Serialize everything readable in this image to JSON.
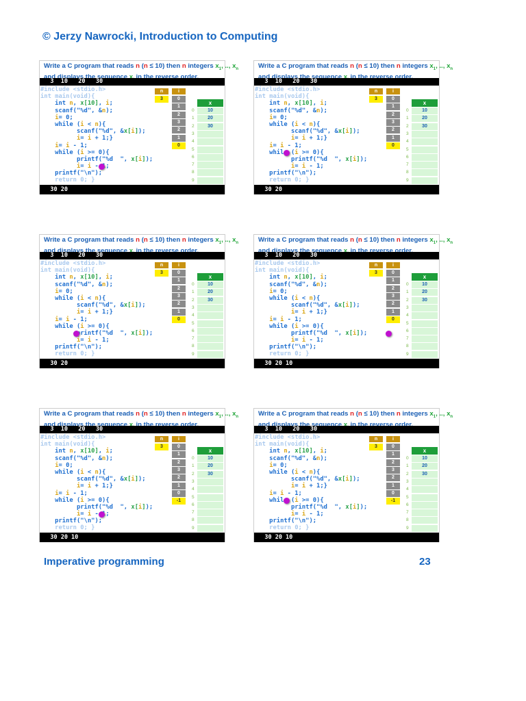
{
  "header": "© Jerzy Nawrocki, Introduction to Computing",
  "footer": {
    "left": "Imperative programming",
    "page": "23"
  },
  "slide_common": {
    "title_line1": [
      "Write a C program that reads ",
      "n",
      " (",
      "n",
      " ≤ 10) then ",
      "n",
      " integers  ",
      "x",
      "1",
      ", .., ",
      "x",
      "n"
    ],
    "title_line2": [
      "and displays the sequence ",
      "x",
      "i",
      " in the reverse order."
    ],
    "input": "   3  10   20   30",
    "n_label": "n",
    "n_value": "3",
    "i_label": "i",
    "x_label": "x",
    "x_indices": [
      "0",
      "1",
      "2",
      "3",
      "4",
      "5",
      "6",
      "7",
      "8",
      "9"
    ],
    "x_values": [
      "10",
      "20",
      "30",
      "",
      "",
      "",
      "",
      "",
      "",
      ""
    ],
    "code": [
      [
        [
          "#include <stdio.h>",
          "lt"
        ]
      ],
      [
        [
          "int main(void){",
          "lt"
        ]
      ],
      [
        [
          "    int ",
          ""
        ],
        [
          "n",
          "v"
        ],
        [
          ", ",
          ""
        ],
        [
          "x[10]",
          "g"
        ],
        [
          ", ",
          ""
        ],
        [
          "i",
          "v"
        ],
        [
          ";",
          ""
        ]
      ],
      [
        [
          "    scanf(\"%d\", &",
          ""
        ],
        [
          "n",
          "v"
        ],
        [
          ");",
          ""
        ]
      ],
      [
        [
          "    ",
          ""
        ],
        [
          "i",
          "v"
        ],
        [
          "= 0;",
          ""
        ]
      ],
      [
        [
          "    while (",
          ""
        ],
        [
          "i",
          "v"
        ],
        [
          " < ",
          ""
        ],
        [
          "n",
          "v"
        ],
        [
          "){",
          ""
        ]
      ],
      [
        [
          "          scanf(\"%d\", &",
          ""
        ],
        [
          "x[",
          "g"
        ],
        [
          "i",
          "v"
        ],
        [
          "]",
          "g"
        ],
        [
          ");",
          ""
        ]
      ],
      [
        [
          "          ",
          ""
        ],
        [
          "i",
          "v"
        ],
        [
          "= ",
          ""
        ],
        [
          "i",
          "v"
        ],
        [
          " + 1;}",
          ""
        ]
      ],
      [
        [
          "    ",
          ""
        ],
        [
          "i",
          "v"
        ],
        [
          "= ",
          ""
        ],
        [
          "i",
          "v"
        ],
        [
          " - 1;",
          ""
        ]
      ],
      [
        [
          "    while (",
          ""
        ],
        [
          "i",
          "v"
        ],
        [
          " >= 0){",
          ""
        ]
      ],
      [
        [
          "          printf(\"%d  \", ",
          ""
        ],
        [
          "x[",
          "g"
        ],
        [
          "i",
          "v"
        ],
        [
          "]",
          "g"
        ],
        [
          ");",
          ""
        ]
      ],
      [
        [
          "          ",
          ""
        ],
        [
          "i",
          "v"
        ],
        [
          "= ",
          ""
        ],
        [
          "i",
          "v"
        ],
        [
          " - 1;",
          ""
        ]
      ],
      [
        [
          "    printf(\"\\n\");",
          ""
        ]
      ],
      [
        [
          "    return 0; }",
          "lt"
        ]
      ]
    ]
  },
  "slides": [
    {
      "i_values": [
        "0",
        "1",
        "2",
        "3",
        "2",
        "1",
        "0"
      ],
      "output": "   30 20"
    },
    {
      "i_values": [
        "0",
        "1",
        "2",
        "3",
        "2",
        "1",
        "0"
      ],
      "output": "   30 20"
    },
    {
      "i_values": [
        "0",
        "1",
        "2",
        "3",
        "2",
        "1",
        "0"
      ],
      "output": "   30 20"
    },
    {
      "i_values": [
        "0",
        "1",
        "2",
        "3",
        "2",
        "1",
        "0"
      ],
      "output": "   30 20 10"
    },
    {
      "i_values": [
        "0",
        "1",
        "2",
        "3",
        "2",
        "1",
        "0",
        "-1"
      ],
      "output": "   30 20 10"
    },
    {
      "i_values": [
        "0",
        "1",
        "2",
        "3",
        "2",
        "1",
        "0",
        "-1"
      ],
      "output": "   30 20 10"
    }
  ]
}
